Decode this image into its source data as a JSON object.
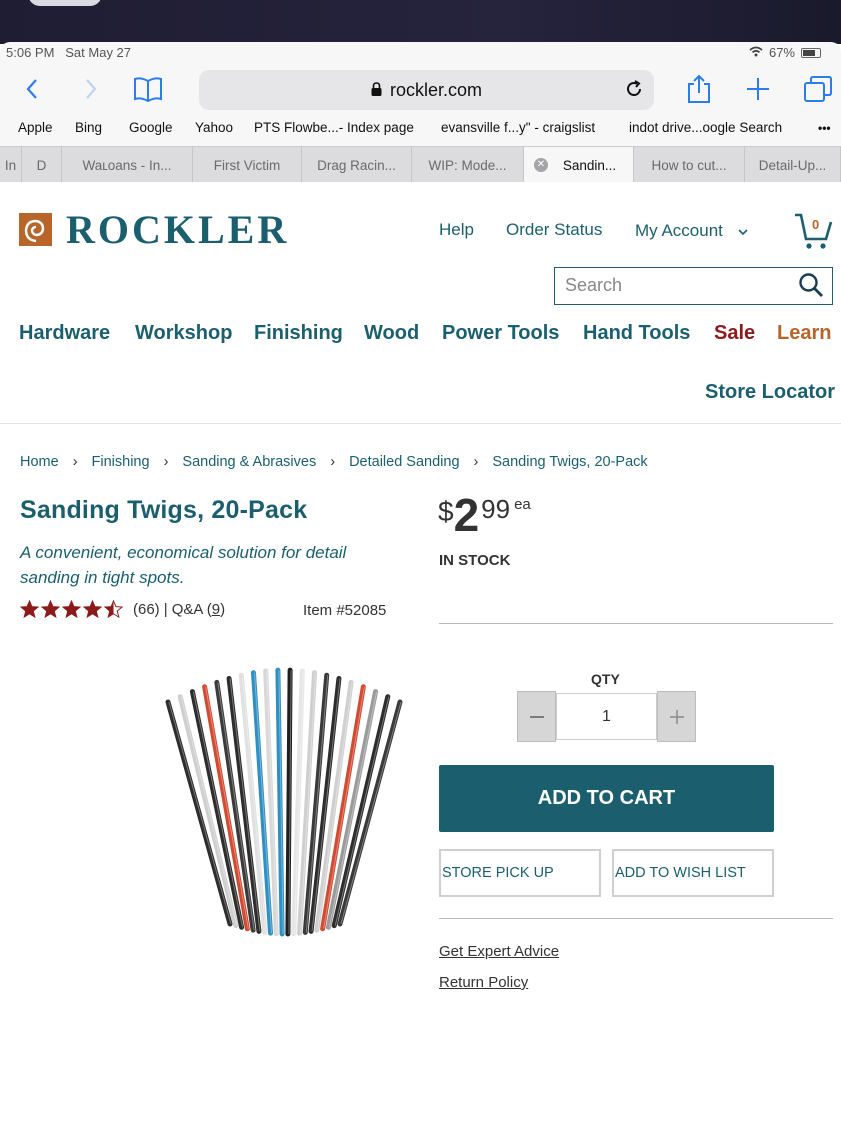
{
  "status_bar": {
    "time": "5:06 PM",
    "date": "Sat May 27",
    "battery": "67%"
  },
  "browser": {
    "url": "rockler.com",
    "favorites": [
      "Apple",
      "Bing",
      "Google",
      "Yahoo",
      "PTS Flowbe...- Index page",
      "evansville f...y\" - craigslist",
      "indot drive...oogle Search",
      "•••"
    ],
    "tabs": [
      {
        "label": "In"
      },
      {
        "label": "D"
      },
      {
        "label": "Waʟoans - In..."
      },
      {
        "label": "First Victim"
      },
      {
        "label": "Drag Racin..."
      },
      {
        "label": "WIP: Mode..."
      },
      {
        "label": "Sandin...",
        "active": true
      },
      {
        "label": "How to cut..."
      },
      {
        "label": "Detail-Up..."
      }
    ]
  },
  "header": {
    "logo": "ROCKLER",
    "help": "Help",
    "order_status": "Order Status",
    "my_account": "My Account",
    "cart_count": "0",
    "search_placeholder": "Search"
  },
  "nav": [
    "Hardware",
    "Workshop",
    "Finishing",
    "Wood",
    "Power Tools",
    "Hand Tools",
    "Sale",
    "Learn"
  ],
  "store_locator": "Store Locator",
  "breadcrumb": [
    "Home",
    "Finishing",
    "Sanding & Abrasives",
    "Detailed Sanding",
    "Sanding Twigs, 20-Pack"
  ],
  "product": {
    "title": "Sanding Twigs, 20-Pack",
    "tagline": "A convenient, economical solution for detail sanding in tight spots.",
    "rating": 4.5,
    "review_count": "(66)",
    "qa_label": "| Q&A (",
    "qa_count": "9",
    "qa_close": ")",
    "item_number": "Item #52085",
    "price_dollar": "$",
    "price_whole": "2",
    "price_cents": "99",
    "price_unit": "ea",
    "stock": "IN STOCK",
    "qty_label": "QTY",
    "qty_value": "1"
  },
  "actions": {
    "add_to_cart": "ADD TO CART",
    "store_pickup": "STORE PICK UP",
    "wish_list": "ADD TO WISH LIST",
    "expert_advice": "Get Expert Advice",
    "return_policy": "Return Policy"
  },
  "colors": {
    "brand_teal": "#1b5f6f",
    "sale_red": "#8c1a1a",
    "learn_orange": "#b8652a",
    "star_red": "#8c1a1a"
  }
}
